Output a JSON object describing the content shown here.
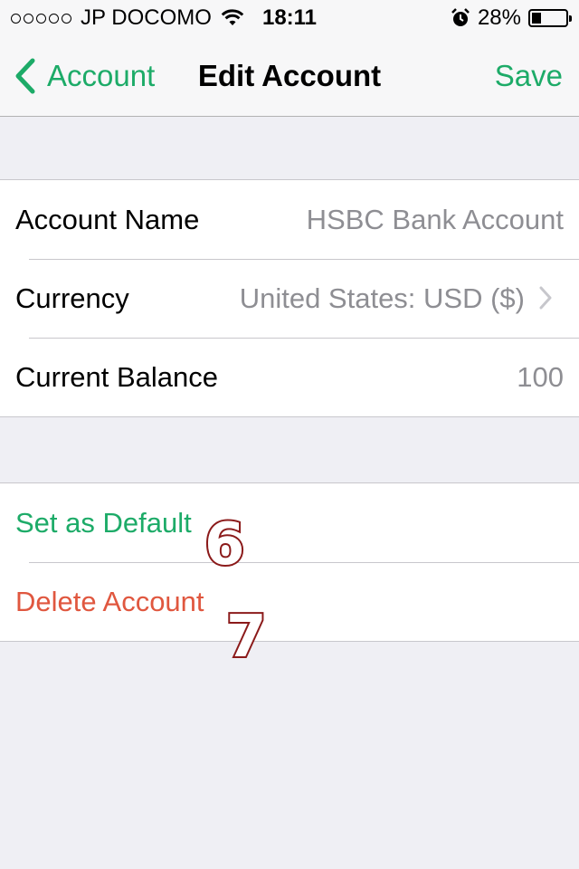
{
  "status_bar": {
    "carrier": "JP DOCOMO",
    "time": "18:11",
    "battery": "28%",
    "battery_level": 0.28,
    "icons": [
      "signal-dots-icon",
      "wifi-icon",
      "alarm-icon",
      "battery-icon"
    ]
  },
  "nav": {
    "back_label": "Account",
    "title": "Edit Account",
    "save_label": "Save"
  },
  "account_fields": [
    {
      "label": "Account Name",
      "value": "HSBC Bank Account"
    },
    {
      "label": "Currency",
      "value": "United States: USD ($)"
    },
    {
      "label": "Current Balance",
      "value": "100"
    }
  ],
  "actions": {
    "set_default": "Set as Default",
    "delete": "Delete Account"
  },
  "markers": [
    "6",
    "7"
  ],
  "colors": {
    "accent": "#1dab68",
    "destructive": "#e0573f",
    "secondary_text": "#8e8e93",
    "background": "#efeff4",
    "marker_outline": "#8b1a1a"
  }
}
